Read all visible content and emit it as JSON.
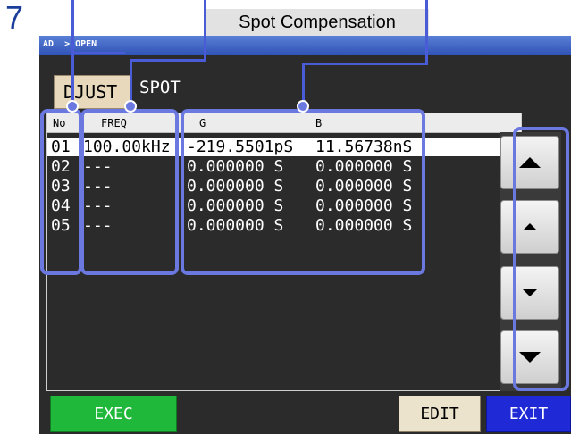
{
  "step_number": "7",
  "callout_title": "Spot Compensation",
  "breadcrumb": "AD  > OPEN",
  "tabs": {
    "adjust_label": "DJUST",
    "spot_label": "SPOT"
  },
  "table": {
    "headers": {
      "no": "No",
      "freq": "FREQ",
      "g": "G",
      "b": "B"
    },
    "rows": [
      {
        "no": "01",
        "freq": "100.00kHz",
        "g": "-219.5501pS",
        "b": "11.56738nS",
        "selected": true
      },
      {
        "no": "02",
        "freq": "---",
        "g": "0.000000 S",
        "b": "0.000000 S"
      },
      {
        "no": "03",
        "freq": "---",
        "g": "0.000000 S",
        "b": "0.000000 S"
      },
      {
        "no": "04",
        "freq": "---",
        "g": "0.000000 S",
        "b": "0.000000 S"
      },
      {
        "no": "05",
        "freq": "---",
        "g": "0.000000 S",
        "b": "0.000000 S"
      }
    ]
  },
  "scroll_buttons": [
    "page-up-icon",
    "line-up-icon",
    "line-down-icon",
    "page-down-icon"
  ],
  "buttons": {
    "exec": "EXEC",
    "edit": "EDIT",
    "exit": "EXIT"
  },
  "colors": {
    "titlebar": "#3b5fc4",
    "exec": "#1fb83b",
    "exit": "#1f2ad6",
    "edit": "#ece3cc",
    "highlight": "#6a78e0"
  }
}
